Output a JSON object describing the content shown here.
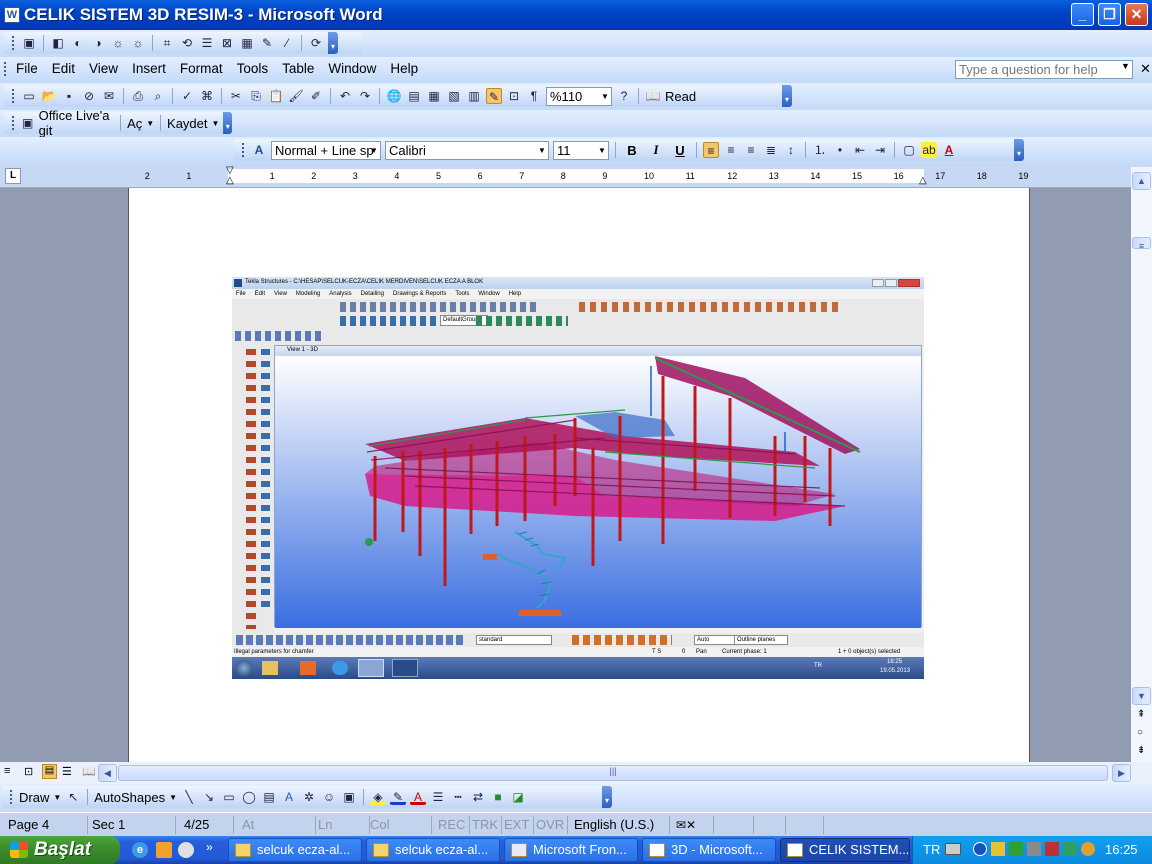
{
  "window": {
    "title": "CELIK SISTEM 3D RESIM-3 - Microsoft Word"
  },
  "menu": {
    "items": [
      "File",
      "Edit",
      "View",
      "Insert",
      "Format",
      "Tools",
      "Table",
      "Window",
      "Help"
    ],
    "help_placeholder": "Type a question for help"
  },
  "standard_toolbar": {
    "zoom": "%110",
    "read_label": "Read"
  },
  "office_live_toolbar": {
    "office_live": "Office Live'a git",
    "open": "Aç",
    "save": "Kaydet"
  },
  "formatting_toolbar": {
    "style": "Normal + Line sp",
    "font": "Calibri",
    "size": "11",
    "bold": "B",
    "italic": "I",
    "underline": "U"
  },
  "ruler": {
    "numbers": [
      "2",
      "1",
      "1",
      "2",
      "3",
      "4",
      "5",
      "6",
      "7",
      "8",
      "9",
      "10",
      "11",
      "12",
      "13",
      "14",
      "15",
      "16",
      "17",
      "18",
      "19"
    ]
  },
  "embedded_image": {
    "title": "Tekla Structures - C:\\HESAP\\SELCUK-ECZA\\CELIK MERDIVEN\\SELCUK ECZA A BLOK",
    "menu": [
      "File",
      "Edit",
      "View",
      "Modeling",
      "Analysis",
      "Detailing",
      "Drawings & Reports",
      "Tools",
      "Window",
      "Help"
    ],
    "group_combo": "DefaultGroup",
    "view_title": "View 1 - 3D",
    "bottom_combo": "standard",
    "auto_combo": "Auto",
    "outline_combo": "Outline planes",
    "status_left": "Illegal parameters for chamfer",
    "status_ts": "T S",
    "status_zero": "0",
    "status_pan": "Pan",
    "status_phase": "Current phase: 1",
    "status_selected": "1 + 0 object(s) selected",
    "taskbar_lang": "TR",
    "taskbar_time": "18:25",
    "taskbar_date": "19.05.2013"
  },
  "draw_toolbar": {
    "draw": "Draw",
    "autoshapes": "AutoShapes"
  },
  "status_bar": {
    "page": "Page 4",
    "sec": "Sec 1",
    "pages": "4/25",
    "at": "At",
    "ln": "Ln",
    "col": "Col",
    "rec": "REC",
    "trk": "TRK",
    "ext": "EXT",
    "ovr": "OVR",
    "language": "English (U.S.)"
  },
  "taskbar": {
    "start": "Başlat",
    "tasks": [
      "selcuk ecza-al...",
      "selcuk ecza-al...",
      "Microsoft Fron...",
      "3D - Microsoft...",
      "CELIK SISTEM..."
    ],
    "lang": "TR",
    "time": "16:25"
  }
}
